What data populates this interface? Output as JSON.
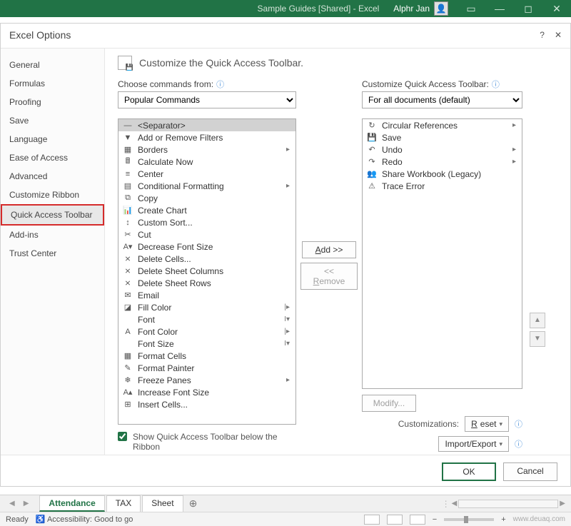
{
  "titlebar": {
    "title": "Sample Guides  [Shared]  -  Excel",
    "user": "Alphr Jan"
  },
  "dialog": {
    "title": "Excel Options",
    "help": "?",
    "close": "✕",
    "sidebar": [
      "General",
      "Formulas",
      "Proofing",
      "Save",
      "Language",
      "Ease of Access",
      "Advanced",
      "Customize Ribbon",
      "Quick Access Toolbar",
      "Add-ins",
      "Trust Center"
    ],
    "sidebar_selected": 8,
    "main_title": "Customize the Quick Access Toolbar.",
    "choose_label": "Choose commands from:",
    "choose_value": "Popular Commands",
    "qat_label": "Customize Quick Access Toolbar:",
    "qat_value": "For all documents (default)",
    "left_list": [
      {
        "icon": "—",
        "label": "<Separator>",
        "sel": true
      },
      {
        "icon": "▼",
        "label": "Add or Remove Filters"
      },
      {
        "icon": "▦",
        "label": "Borders",
        "sub": "▸"
      },
      {
        "icon": "🖩",
        "label": "Calculate Now"
      },
      {
        "icon": "≡",
        "label": "Center"
      },
      {
        "icon": "▤",
        "label": "Conditional Formatting",
        "sub": "▸"
      },
      {
        "icon": "⧉",
        "label": "Copy"
      },
      {
        "icon": "📊",
        "label": "Create Chart"
      },
      {
        "icon": "↕",
        "label": "Custom Sort..."
      },
      {
        "icon": "✂",
        "label": "Cut"
      },
      {
        "icon": "A▾",
        "label": "Decrease Font Size"
      },
      {
        "icon": "⨯",
        "label": "Delete Cells..."
      },
      {
        "icon": "⨯",
        "label": "Delete Sheet Columns"
      },
      {
        "icon": "⨯",
        "label": "Delete Sheet Rows"
      },
      {
        "icon": "✉",
        "label": "Email"
      },
      {
        "icon": "◪",
        "label": "Fill Color",
        "sub": "|▸"
      },
      {
        "icon": " ",
        "label": "Font",
        "sub": "I▾"
      },
      {
        "icon": "A",
        "label": "Font Color",
        "sub": "|▸"
      },
      {
        "icon": " ",
        "label": "Font Size",
        "sub": "I▾"
      },
      {
        "icon": "▦",
        "label": "Format Cells"
      },
      {
        "icon": "✎",
        "label": "Format Painter"
      },
      {
        "icon": "❄",
        "label": "Freeze Panes",
        "sub": "▸"
      },
      {
        "icon": "A▴",
        "label": "Increase Font Size"
      },
      {
        "icon": "⊞",
        "label": "Insert Cells..."
      }
    ],
    "right_list": [
      {
        "icon": "↻",
        "label": "Circular References",
        "sub": "▸"
      },
      {
        "icon": "💾",
        "label": "Save"
      },
      {
        "icon": "↶",
        "label": "Undo",
        "sub": "▸"
      },
      {
        "icon": "↷",
        "label": "Redo",
        "sub": "▸"
      },
      {
        "icon": "👥",
        "label": "Share Workbook (Legacy)"
      },
      {
        "icon": "⚠",
        "label": "Trace Error"
      }
    ],
    "add_btn": "Add >>",
    "remove_btn": "<< Remove",
    "modify_btn": "Modify...",
    "show_below": "Show Quick Access Toolbar below the Ribbon",
    "cust_label": "Customizations:",
    "reset_btn": "Reset",
    "import_btn": "Import/Export",
    "ok": "OK",
    "cancel": "Cancel"
  },
  "tabs": {
    "items": [
      "Attendance",
      "TAX",
      "Sheet"
    ],
    "active": 0
  },
  "status": {
    "ready": "Ready",
    "access": "Accessibility: Good to go",
    "zoom": "100%",
    "watermark": "www.deuaq.com"
  }
}
